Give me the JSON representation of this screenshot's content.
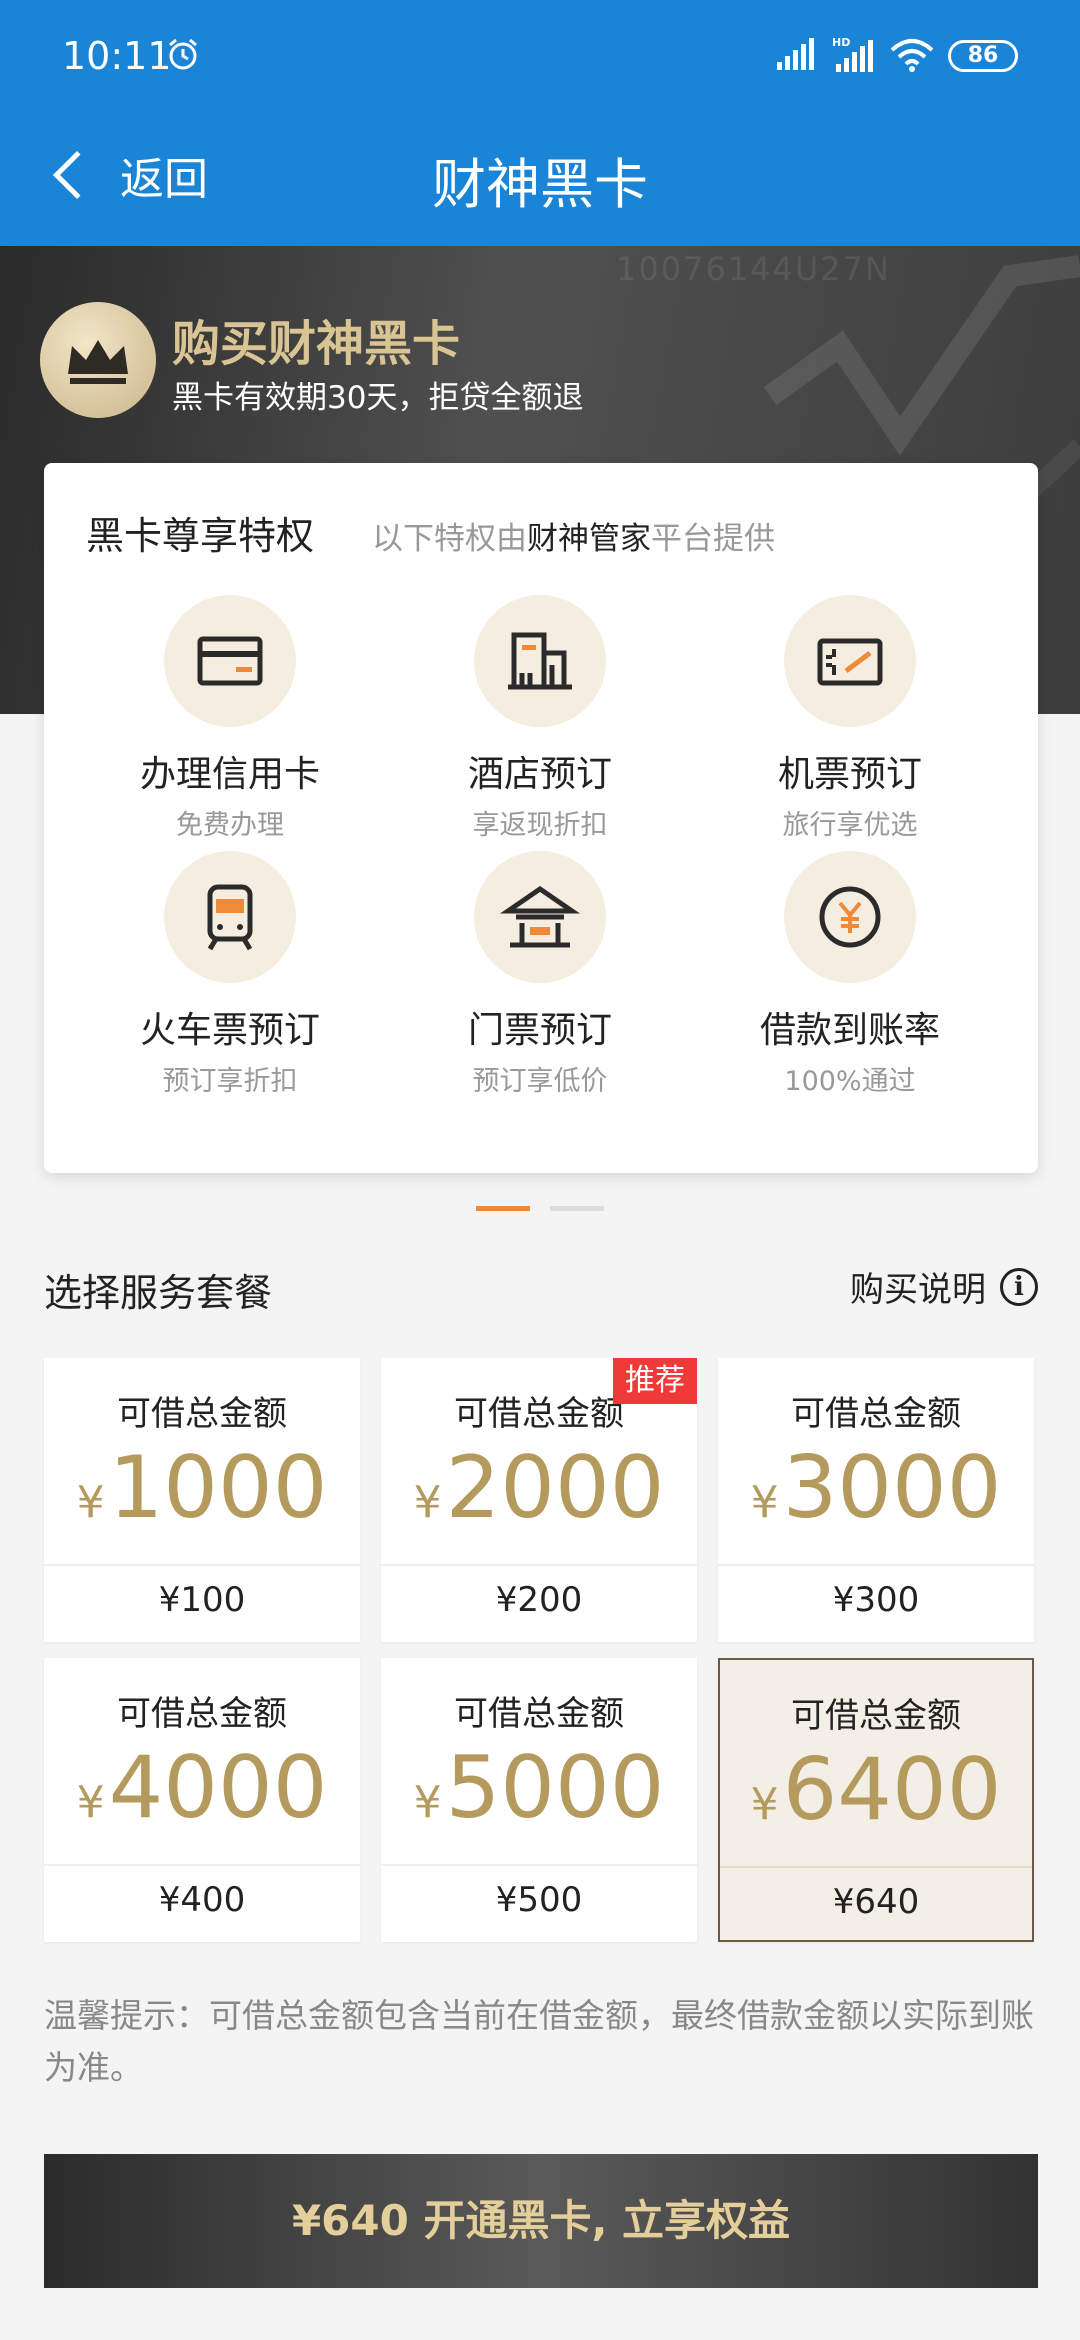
{
  "status": {
    "time": "10:11",
    "battery": "86",
    "network_label": "HD"
  },
  "nav": {
    "back_label": "返回",
    "title": "财神黑卡"
  },
  "banner": {
    "serial": "10076144U27N",
    "title": "购买财神黑卡",
    "subtitle": "黑卡有效期30天，拒贷全额退"
  },
  "privileges": {
    "title": "黑卡尊享特权",
    "note_prefix": "以下特权由",
    "note_highlight": "财神管家",
    "note_suffix": "平台提供",
    "items": [
      {
        "name": "办理信用卡",
        "sub": "免费办理",
        "icon": "credit-card-icon"
      },
      {
        "name": "酒店预订",
        "sub": "享返现折扣",
        "icon": "hotel-icon"
      },
      {
        "name": "机票预订",
        "sub": "旅行享优选",
        "icon": "plane-ticket-icon"
      },
      {
        "name": "火车票预订",
        "sub": "预订享折扣",
        "icon": "train-icon"
      },
      {
        "name": "门票预订",
        "sub": "预订享低价",
        "icon": "pavilion-icon"
      },
      {
        "name": "借款到账率",
        "sub": "100%通过",
        "icon": "yuan-coin-icon"
      }
    ]
  },
  "pager": {
    "active_index": 0,
    "total": 2
  },
  "plans_section": {
    "title": "选择服务套餐",
    "help_label": "购买说明"
  },
  "plans": [
    {
      "label": "可借总金额",
      "currency": "¥",
      "amount": "1000",
      "price": "¥100",
      "badge": "",
      "selected": false
    },
    {
      "label": "可借总金额",
      "currency": "¥",
      "amount": "2000",
      "price": "¥200",
      "badge": "推荐",
      "selected": false
    },
    {
      "label": "可借总金额",
      "currency": "¥",
      "amount": "3000",
      "price": "¥300",
      "badge": "",
      "selected": false
    },
    {
      "label": "可借总金额",
      "currency": "¥",
      "amount": "4000",
      "price": "¥400",
      "badge": "",
      "selected": false
    },
    {
      "label": "可借总金额",
      "currency": "¥",
      "amount": "5000",
      "price": "¥500",
      "badge": "",
      "selected": false
    },
    {
      "label": "可借总金额",
      "currency": "¥",
      "amount": "6400",
      "price": "¥640",
      "badge": "",
      "selected": true
    }
  ],
  "tip": "温馨提示：可借总金额包含当前在借金额，最终借款金额以实际到账为准。",
  "cta": "¥640 开通黑卡, 立享权益",
  "colors": {
    "header": "#1a84d6",
    "gold": "#b59a5e",
    "badge": "#f03a3a",
    "accent_orange": "#f08a3b"
  }
}
